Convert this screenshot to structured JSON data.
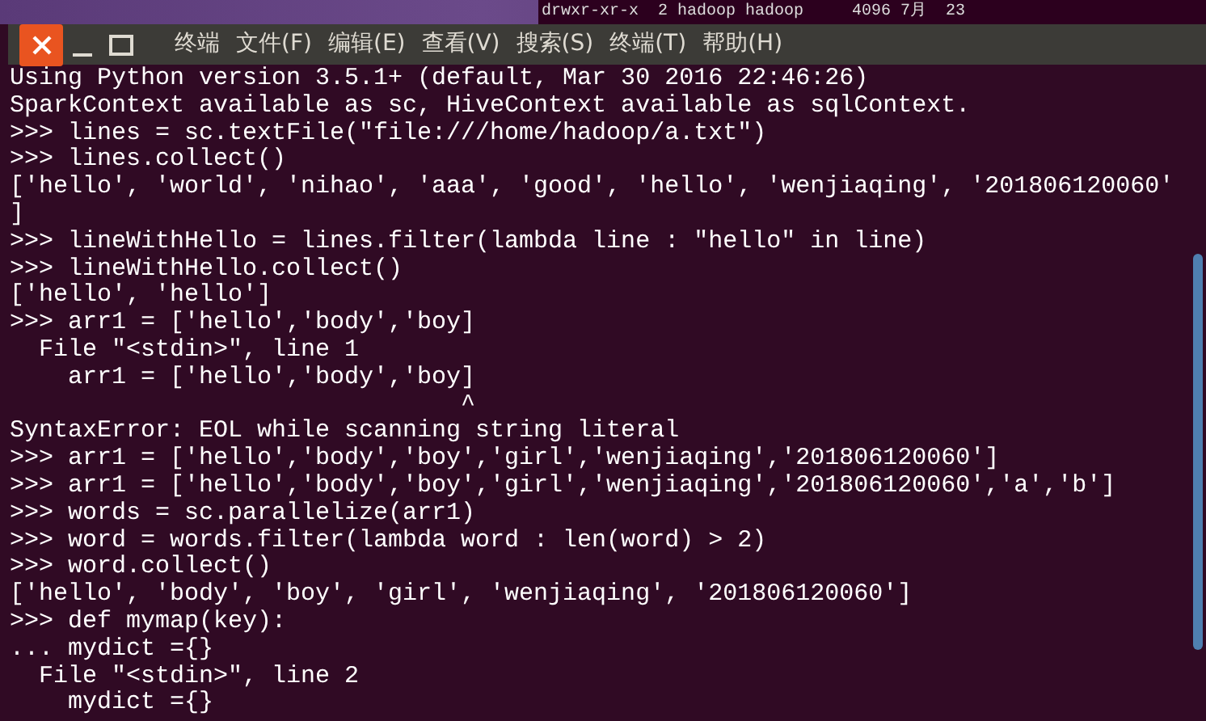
{
  "background_window": {
    "text": "drwxr-xr-x  2 hadoop hadoop     4096 7月  23"
  },
  "title_bar": {
    "menu": [
      "终端",
      "文件(F)",
      "编辑(E)",
      "查看(V)",
      "搜索(S)",
      "终端(T)",
      "帮助(H)"
    ]
  },
  "terminal": {
    "lines": [
      "Using Python version 3.5.1+ (default, Mar 30 2016 22:46:26)",
      "SparkContext available as sc, HiveContext available as sqlContext.",
      ">>> lines = sc.textFile(\"file:///home/hadoop/a.txt\")",
      ">>> lines.collect()",
      "['hello', 'world', 'nihao', 'aaa', 'good', 'hello', 'wenjiaqing', '201806120060'",
      "]",
      ">>> lineWithHello = lines.filter(lambda line : \"hello\" in line)",
      ">>> lineWithHello.collect()",
      "['hello', 'hello']",
      ">>> arr1 = ['hello','body','boy]",
      "  File \"<stdin>\", line 1",
      "    arr1 = ['hello','body','boy]",
      "                               ^",
      "SyntaxError: EOL while scanning string literal",
      ">>> arr1 = ['hello','body','boy','girl','wenjiaqing','201806120060']",
      ">>> arr1 = ['hello','body','boy','girl','wenjiaqing','201806120060','a','b']",
      ">>> words = sc.parallelize(arr1)",
      ">>> word = words.filter(lambda word : len(word) > 2)",
      ">>> word.collect()",
      "['hello', 'body', 'boy', 'girl', 'wenjiaqing', '201806120060']",
      ">>> def mymap(key):",
      "... mydict ={}",
      "  File \"<stdin>\", line 2",
      "    mydict ={}"
    ]
  }
}
